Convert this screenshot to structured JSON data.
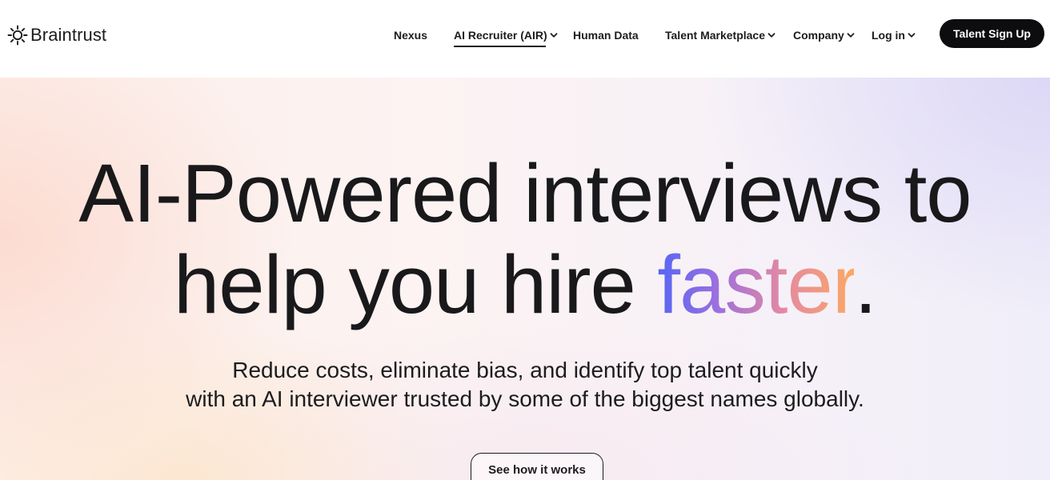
{
  "brand": {
    "name": "Braintrust",
    "logo_icon": "sun-gear-icon"
  },
  "nav": {
    "items": [
      {
        "label": "Nexus",
        "dropdown": false
      },
      {
        "label": "AI Recruiter (AIR)",
        "dropdown": true,
        "active": true
      },
      {
        "label": "Human Data",
        "dropdown": false
      },
      {
        "label": "Talent Marketplace",
        "dropdown": true
      },
      {
        "label": "Company",
        "dropdown": true
      },
      {
        "label": "Log in",
        "dropdown": true
      }
    ],
    "signup_label": "Talent Sign Up"
  },
  "hero": {
    "title_line1": "AI-Powered interviews to",
    "title_line2_prefix": "help you hire ",
    "title_accent": "faster",
    "title_suffix": ".",
    "subtitle_line1": "Reduce costs, eliminate bias, and identify top talent quickly",
    "subtitle_line2": "with an AI interviewer trusted by some of the biggest names globally.",
    "cta_label": "See how it works"
  },
  "colors": {
    "accent_gradient": [
      "#5566f4",
      "#9b6fe0",
      "#e58aa0",
      "#fca865"
    ],
    "button_dark": "#0d0d10",
    "text": "#19191b"
  }
}
